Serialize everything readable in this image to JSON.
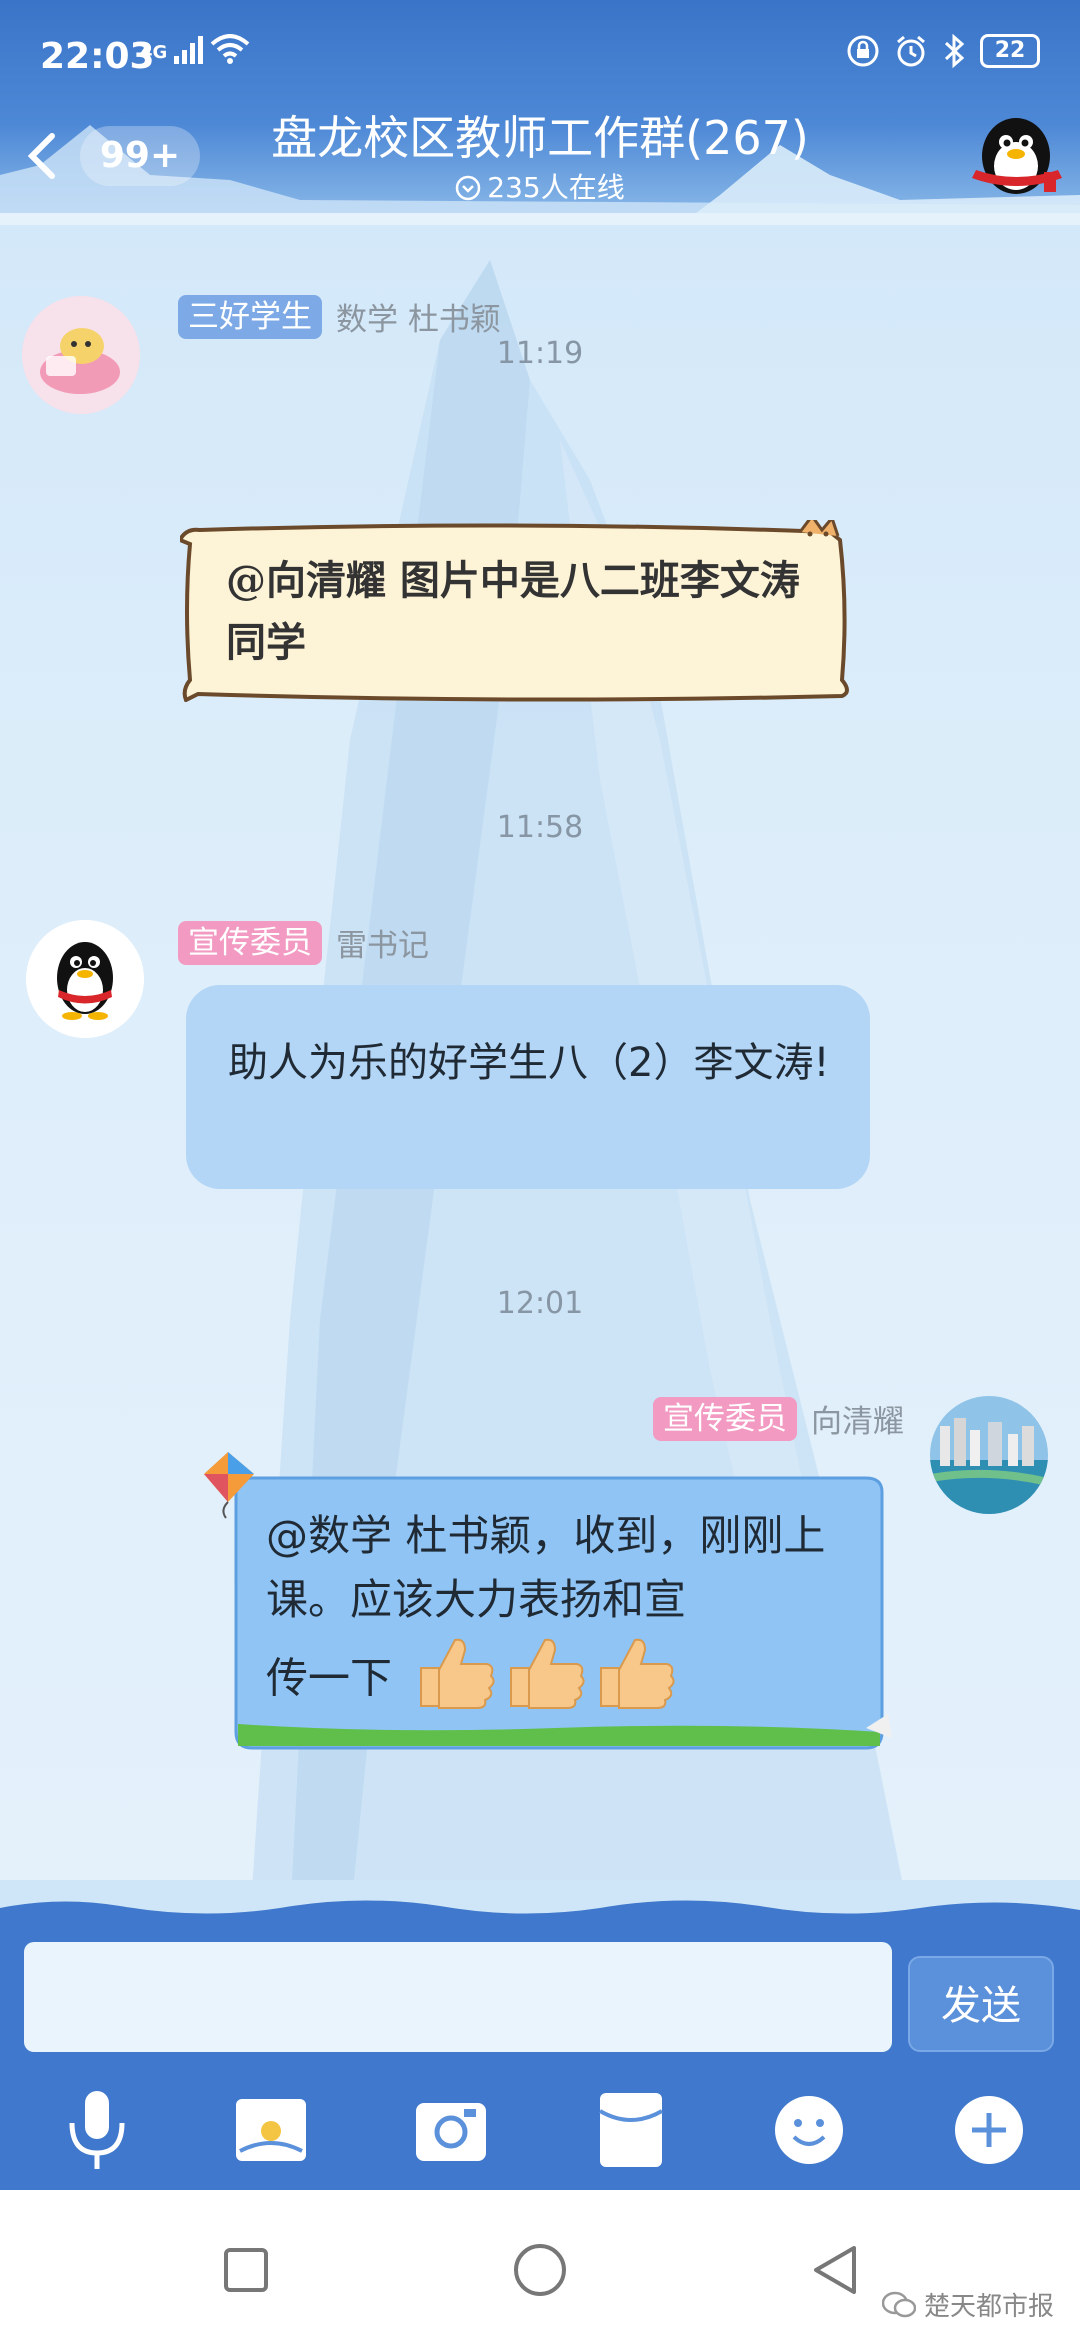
{
  "status_bar": {
    "time": "22:03",
    "signal": "4G",
    "battery": "22"
  },
  "header": {
    "unread_count": "99+",
    "title": "盘龙校区教师工作群(267)",
    "online": "235人在线"
  },
  "messages": [
    {
      "time": "11:19",
      "role": "三好学生",
      "sender": "数学 杜书颖",
      "text": "@向清耀 图片中是八二班李文涛同学"
    },
    {
      "time": "11:58",
      "role": "宣传委员",
      "sender": "雷书记",
      "text": "助人为乐的好学生八（2）李文涛!"
    },
    {
      "time": "12:01",
      "role": "宣传委员",
      "sender": "向清耀",
      "text_line1": "@数学 杜书颖，收到，刚刚上课。应该大力表扬和宣",
      "text_line2": "传一下"
    }
  ],
  "input": {
    "placeholder": "",
    "send_label": "发送"
  },
  "toolbar_icons": [
    "microphone-icon",
    "image-icon",
    "camera-icon",
    "red-packet-icon",
    "emoji-icon",
    "plus-icon"
  ],
  "navbar_icons": [
    "recents-icon",
    "home-icon",
    "back-icon"
  ],
  "watermark": "楚天都市报",
  "colors": {
    "header": "#3a74c8",
    "tag_blue": "#7da9e6",
    "tag_pink": "#f29ac2",
    "bubble_blue": "#b3d6f6",
    "send": "#5b90da"
  }
}
